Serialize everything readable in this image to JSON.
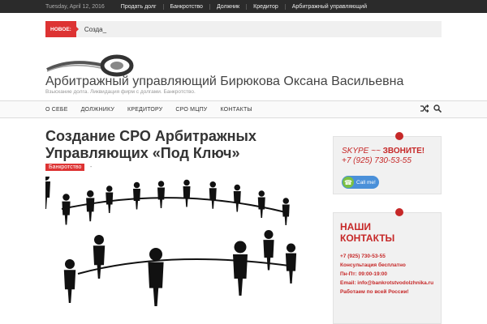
{
  "topbar": {
    "date": "Tuesday, April 12, 2016",
    "links": [
      "Продать долг",
      "Банкротство",
      "Должник",
      "Кредитор",
      "Арбитражный управляющий"
    ]
  },
  "ticker": {
    "badge": "НОВОЕ:",
    "text": "Созда_"
  },
  "header": {
    "title": "Арбитражный управляющий Бирюкова Оксана Васильевна",
    "description": "Взыскание долга. Ликвидация фирм с долгами. Банкротство."
  },
  "nav": {
    "items": [
      "О СЕБЕ",
      "ДОЛЖНИКУ",
      "КРЕДИТОРУ",
      "СРО МЦПУ",
      "КОНТАКТЫ"
    ],
    "icons": [
      "shuffle-icon",
      "search-icon"
    ]
  },
  "post": {
    "title": "Создание СРО Арбитражных Управляющих «Под Ключ»",
    "category": "Банкротство",
    "meta_sep": "-"
  },
  "sidebar": {
    "skype_prefix": "SKYPE ~~ ",
    "skype_call": "ЗВОНИТЕ!",
    "phone": "+7 (925) 730-53-55",
    "call_button": "Call me!",
    "contacts_title": "НАШИ КОНТАКТЫ",
    "contact_lines": [
      "+7 (925) 730-53-55",
      "Консультация бесплатно",
      "Пн-Пт: 09:00-19:00",
      "Email: info@bankrotstvodolzhnika.ru",
      "Работаем по всей России!"
    ]
  },
  "colors": {
    "accent": "#d33333",
    "topbar": "#2b2b2b"
  }
}
